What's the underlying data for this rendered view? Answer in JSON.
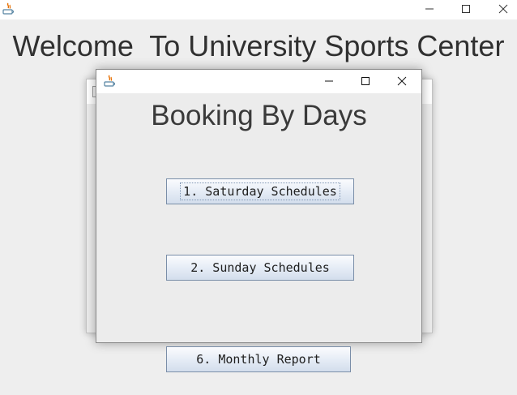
{
  "main_window": {
    "heading": "Welcome  To University Sports Center",
    "icon": "java-icon",
    "controls": [
      "minimize-icon",
      "maximize-icon",
      "close-icon"
    ],
    "buttons": {
      "monthly_report": "6. Monthly Report"
    }
  },
  "back_dialog": {
    "icon": "java-icon"
  },
  "dialog": {
    "title": "Booking By Days",
    "icon": "java-icon",
    "controls": [
      "minimize-icon",
      "maximize-icon",
      "close-icon"
    ],
    "buttons": {
      "saturday": "1. Saturday Schedules",
      "sunday": "2. Sunday Schedules"
    },
    "focused_button": "saturday"
  },
  "colors": {
    "background": "#eeeeee",
    "titlebar": "#ffffff",
    "button_border": "#7a8ea8",
    "text": "#303030"
  }
}
